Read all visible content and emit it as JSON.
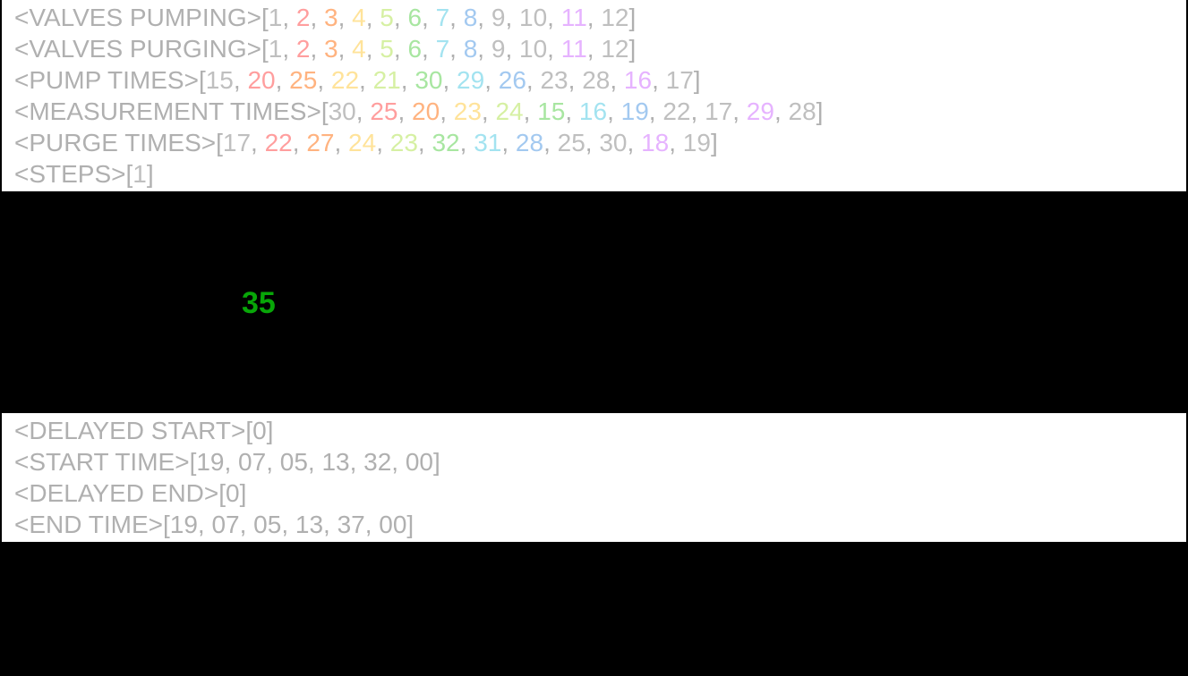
{
  "top": {
    "valves_pumping": {
      "tag": "<VALVES PUMPING>",
      "values": [
        "1",
        "2",
        "3",
        "4",
        "5",
        "6",
        "7",
        "8",
        "9",
        "10",
        "11",
        "12"
      ]
    },
    "valves_purging": {
      "tag": "<VALVES PURGING>",
      "values": [
        "1",
        "2",
        "3",
        "4",
        "5",
        "6",
        "7",
        "8",
        "9",
        "10",
        "11",
        "12"
      ]
    },
    "pump_times": {
      "tag": "<PUMP TIMES>",
      "values": [
        "15",
        "20",
        "25",
        "22",
        "21",
        "30",
        "29",
        "26",
        "23",
        "28",
        "16",
        "17"
      ]
    },
    "measurement_times": {
      "tag": "<MEASUREMENT TIMES>",
      "values": [
        "30",
        "25",
        "20",
        "23",
        "24",
        "15",
        "16",
        "19",
        "22",
        "17",
        "29",
        "28"
      ]
    },
    "purge_times": {
      "tag": "<PURGE TIMES>",
      "values": [
        "17",
        "22",
        "27",
        "24",
        "23",
        "32",
        "31",
        "28",
        "25",
        "30",
        "18",
        "19"
      ]
    },
    "steps": {
      "tag": "<STEPS>",
      "single": "1"
    }
  },
  "middle": {
    "big_number": "35"
  },
  "bottom": {
    "delayed_start": {
      "tag": "<DELAYED START>",
      "text": "[0]"
    },
    "start_time": {
      "tag": "<START TIME>",
      "text": "[19, 07, 05, 13, 32, 00]"
    },
    "delayed_end": {
      "tag": "<DELAYED END>",
      "text": "[0]"
    },
    "end_time": {
      "tag": "<END TIME>",
      "text": "[19, 07, 05, 13, 37, 00]"
    }
  }
}
